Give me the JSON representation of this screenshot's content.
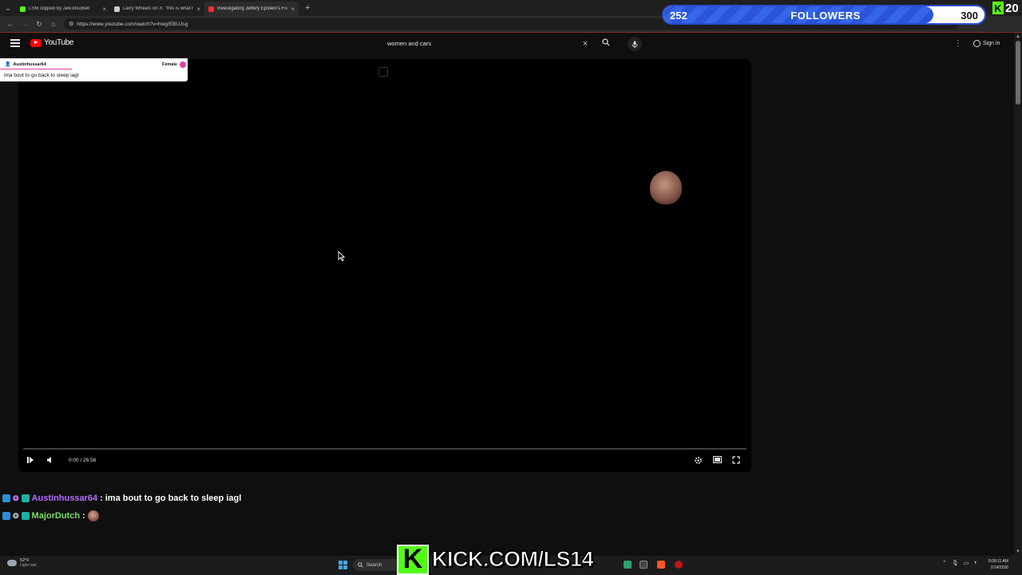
{
  "browser": {
    "tabs": [
      {
        "title": "LSM clipped by JewJitsuBelt",
        "favicon_color": "#53fc18",
        "active": false
      },
      {
        "title": "Larry Wheels on X: \"this is what h...",
        "favicon_color": "#cccccc",
        "active": false
      },
      {
        "title": "Investigating Jeffery Epstein's Fo...",
        "favicon_color": "#ff2d2d",
        "active": true
      }
    ],
    "url": "https://www.youtube.com/watch?v=hwg/EBUJsg"
  },
  "followers_goal": {
    "current": "252",
    "label": "FOLLOWERS",
    "goal": "300",
    "progress": 0.84
  },
  "kick_top": {
    "count": "20"
  },
  "youtube": {
    "logo_text": "YouTube",
    "search_value": "women and cars",
    "signin_label": "Sign in"
  },
  "player": {
    "time": "0:00 / 26:56",
    "progress": 0.0
  },
  "overlay_message": {
    "username": "Austinhussar64",
    "gender_label": "Female",
    "message": "ima bout to go back to sleep iagl"
  },
  "chat": [
    {
      "user": "Austinhussar64",
      "sep": ":",
      "text": "ima bout to go back to sleep iagl",
      "name_color": "#b36bff"
    },
    {
      "user": "MajorDutch",
      "sep": ":",
      "text": "",
      "name_color": "#7bdc6a"
    }
  ],
  "taskbar": {
    "weather_temp": "52°F",
    "weather_desc": "Light rain",
    "search_label": "Search",
    "time": "8:08:11 AM",
    "date": "2/14/2026"
  },
  "kick_banner": {
    "logo": "K",
    "url": "KICK.COM/LS14"
  }
}
